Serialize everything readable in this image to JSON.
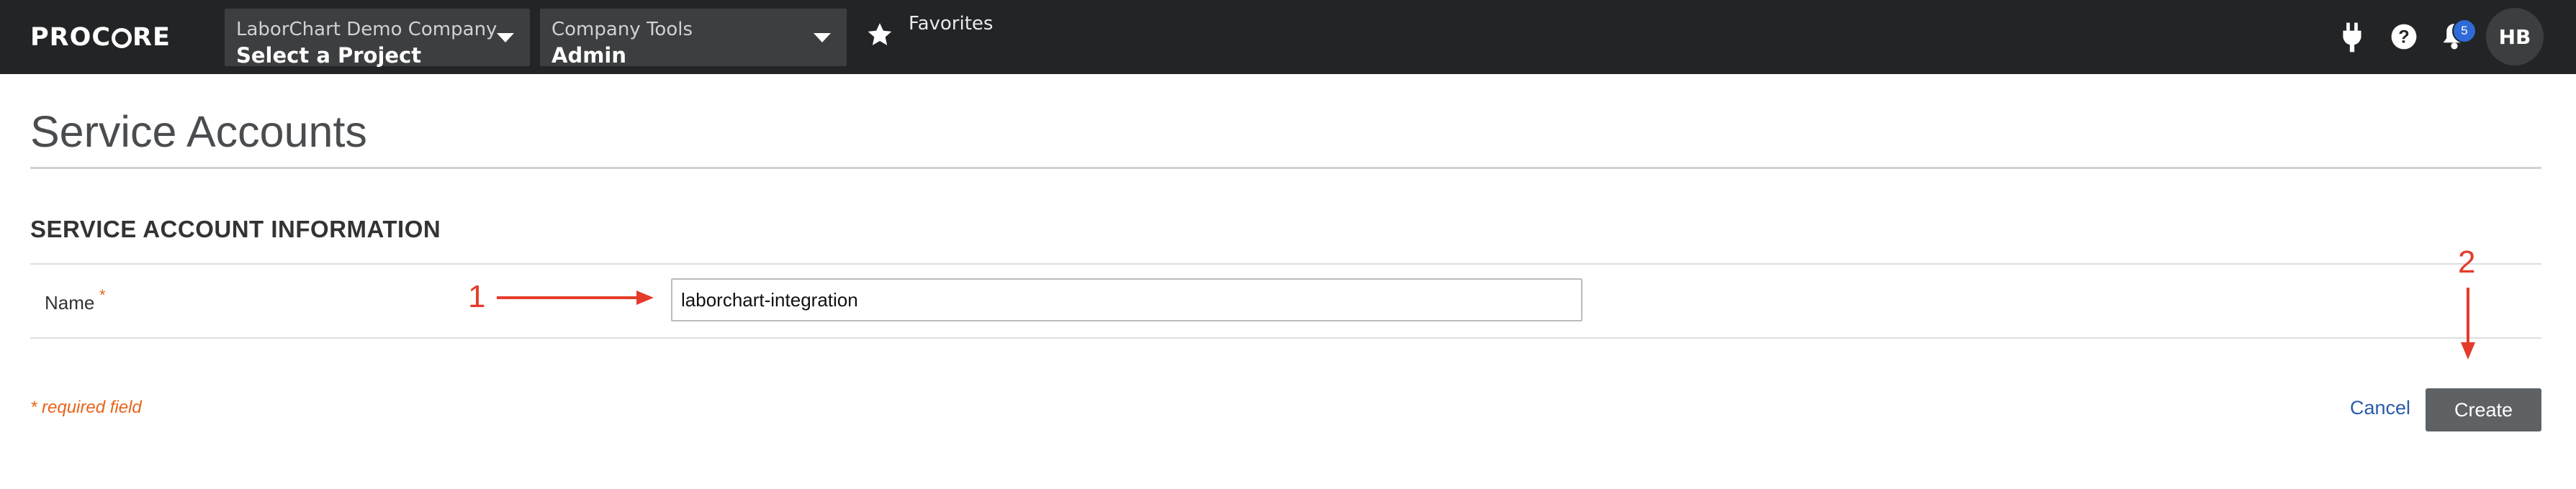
{
  "topnav": {
    "logo_left": "PROC",
    "logo_right": "RE",
    "project_selector": {
      "company": "LaborChart Demo Company",
      "project": "Select a Project"
    },
    "tools_selector": {
      "label": "Company Tools",
      "value": "Admin"
    },
    "favorites_label": "Favorites",
    "notification_count": "5",
    "avatar_initials": "HB",
    "icons": [
      "plug-icon",
      "help-icon",
      "bell-icon",
      "star-icon"
    ]
  },
  "page": {
    "title": "Service Accounts",
    "section_title": "SERVICE ACCOUNT INFORMATION",
    "fields": {
      "name_label": "Name",
      "required_marker": "*",
      "name_value": "laborchart-integration"
    },
    "required_note": "* required field",
    "cancel_label": "Cancel",
    "create_label": "Create"
  },
  "annotations": {
    "step1": "1",
    "step2": "2",
    "color": "#e53b2a"
  },
  "colors": {
    "nav_bg": "#222426",
    "dropdown_bg": "#3c3e40",
    "required_orange": "#e8641a",
    "link_blue": "#2a5caa",
    "button_gray": "#5f6265",
    "badge_blue": "#2f6ad6"
  }
}
